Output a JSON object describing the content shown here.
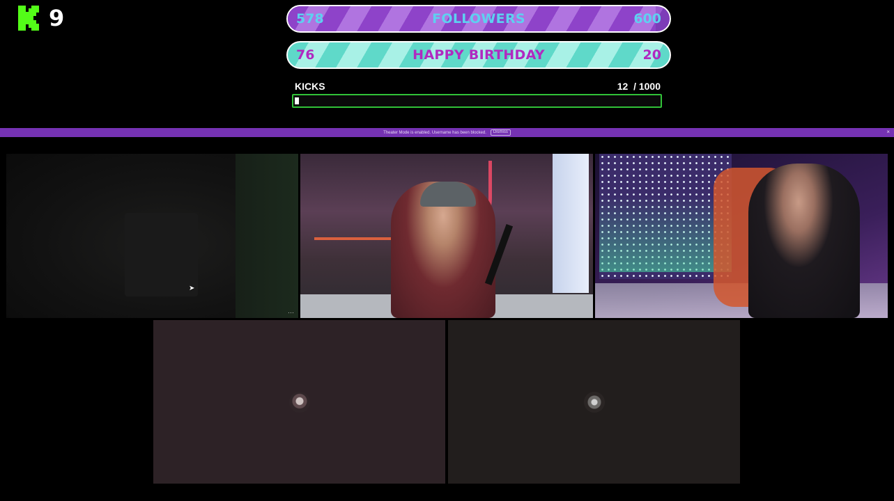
{
  "channel": {
    "logo_letter": "K",
    "viewer_count": "9"
  },
  "goals": {
    "followers": {
      "current": "578",
      "title": "FOLLOWERS",
      "target": "600",
      "progress": 0.963
    },
    "birthday": {
      "current": "76",
      "title": "HAPPY BIRTHDAY",
      "target": "20"
    }
  },
  "kicks": {
    "label": "KICKS",
    "current": "12",
    "total": "/ 1000",
    "progress": 0.012
  },
  "notification_bar": {
    "message": "Theater Mode is enabled. Username has been blocked.",
    "action_label": "Dismiss",
    "close_glyph": "×",
    "color": "#7532b3"
  },
  "video_grid": {
    "tiles": [
      {
        "id": "participant-1",
        "more_glyph": "⋯"
      },
      {
        "id": "participant-2"
      },
      {
        "id": "participant-3"
      },
      {
        "id": "participant-4"
      },
      {
        "id": "participant-5"
      }
    ]
  },
  "colors": {
    "brand_green": "#53fc18",
    "kicks_border": "#31c238",
    "followers_text": "#5ed0f0",
    "birthday_text": "#b02ac0"
  }
}
